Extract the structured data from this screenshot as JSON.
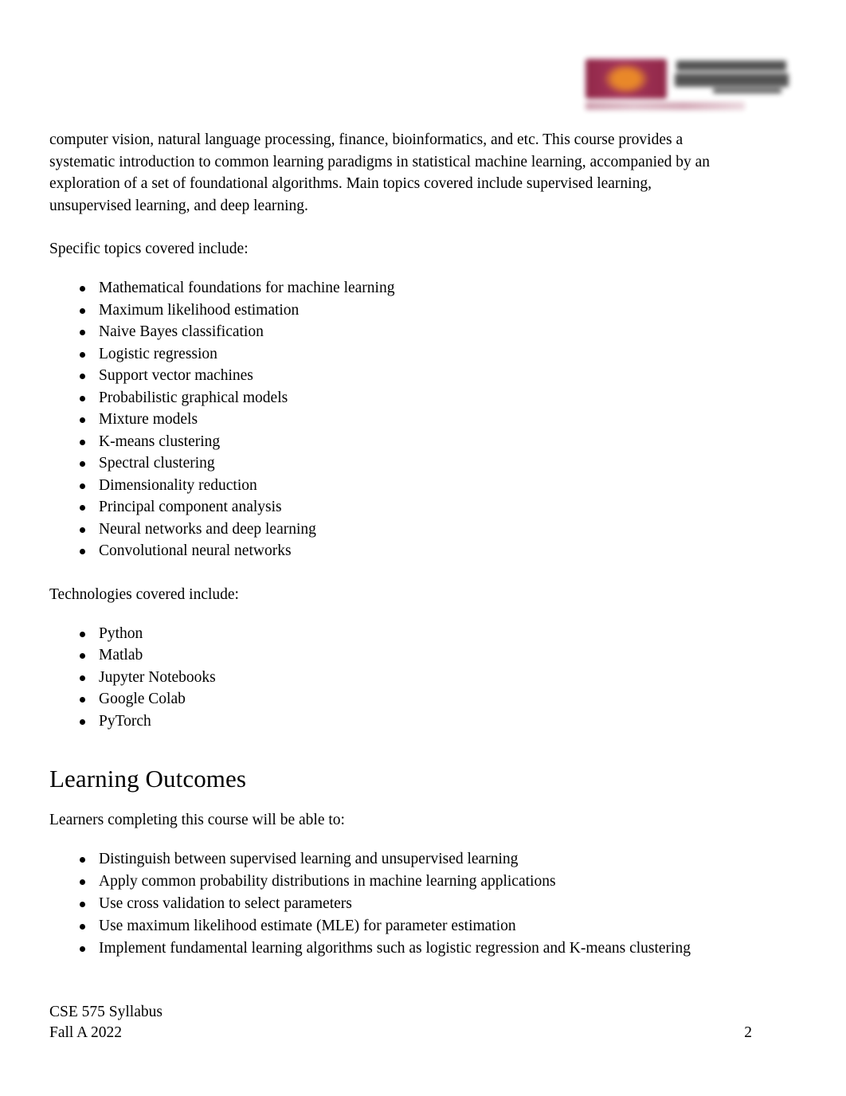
{
  "document": {
    "header": {
      "logo_alt": "ASU Ira A. Fulton Schools of Engineering logo"
    },
    "body": {
      "intro_paragraph": "computer vision, natural language processing, finance, bioinformatics, and etc. This course provides a systematic introduction to common learning paradigms in statistical machine learning, accompanied by an exploration of a set of foundational algorithms. Main topics covered include supervised learning, unsupervised learning, and deep learning.",
      "topics_lead": "Specific topics covered include:",
      "topics": [
        "Mathematical foundations for machine learning",
        "Maximum likelihood estimation",
        "Naive Bayes classification",
        "Logistic regression",
        "Support vector machines",
        "Probabilistic graphical models",
        "Mixture models",
        "K-means clustering",
        "Spectral clustering",
        "Dimensionality reduction",
        "Principal component analysis",
        "Neural networks and deep learning",
        "Convolutional neural networks"
      ],
      "technologies_lead": "Technologies covered include:",
      "technologies": [
        "Python",
        "Matlab",
        "Jupyter Notebooks",
        "Google Colab",
        "PyTorch"
      ],
      "learning_outcomes_heading": "Learning Outcomes",
      "learning_outcomes_lead": "Learners completing this course will be able to:",
      "learning_outcomes": [
        "Distinguish between supervised learning and unsupervised learning",
        "Apply common probability distributions in machine learning applications",
        "Use cross validation to select parameters",
        "Use maximum likelihood estimate (MLE) for parameter estimation",
        "Implement fundamental learning algorithms such as logistic regression and K-means clustering"
      ]
    },
    "footer": {
      "line1": "CSE 575 Syllabus",
      "line2": "Fall A 2022",
      "page_number": "2"
    },
    "colors": {
      "page_background": "#ffffff",
      "text": "#000000",
      "logo_maroon": "#8c1d40",
      "logo_gold": "#e8821e",
      "logo_wordmark_gray": "#3a3a3a"
    }
  }
}
